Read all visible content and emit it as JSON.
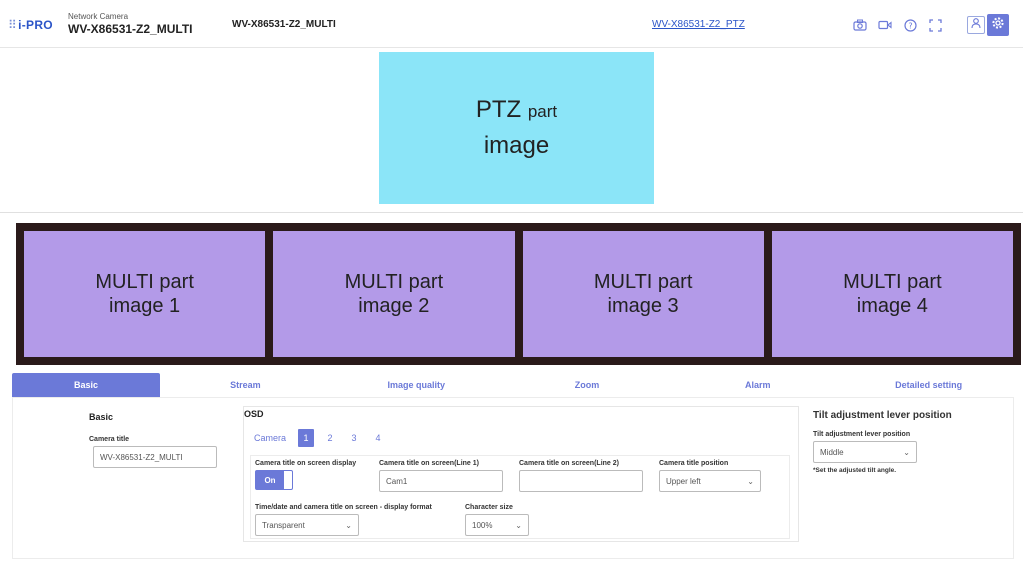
{
  "header": {
    "logo": "i-PRO",
    "logo_dots": "⠿",
    "model_sub": "Network Camera",
    "model_main": "WV-X86531-Z2_MULTI",
    "camera_name": "WV-X86531-Z2_MULTI",
    "ptz_link": "WV-X86531-Z2_PTZ"
  },
  "ptz_image": {
    "label_big": "PTZ",
    "label_small": "part",
    "label_line2": "image"
  },
  "multi_images": [
    {
      "line1": "MULTI part",
      "line2": "image 1"
    },
    {
      "line1": "MULTI part",
      "line2": "image 2"
    },
    {
      "line1": "MULTI part",
      "line2": "image 3"
    },
    {
      "line1": "MULTI part",
      "line2": "image 4"
    }
  ],
  "tabs": [
    "Basic",
    "Stream",
    "Image quality",
    "Zoom",
    "Alarm",
    "Detailed setting"
  ],
  "basic": {
    "title": "Basic",
    "camera_title_label": "Camera title",
    "camera_title_value": "WV-X86531-Z2_MULTI"
  },
  "osd": {
    "title": "OSD",
    "camera_tabs": [
      "Camera",
      "1",
      "2",
      "3",
      "4"
    ],
    "title_display_label": "Camera title on screen display",
    "toggle_value": "On",
    "line1_label": "Camera title on screen(Line 1)",
    "line1_value": "Cam1",
    "line2_label": "Camera title on screen(Line 2)",
    "line2_value": "",
    "position_label": "Camera title position",
    "position_value": "Upper left",
    "timedate_label": "Time/date and camera title on screen - display format",
    "timedate_value": "Transparent",
    "char_size_label": "Character size",
    "char_size_value": "100%"
  },
  "tilt": {
    "title": "Tilt adjustment lever position",
    "label": "Tilt adjustment lever position",
    "value": "Middle",
    "note": "*Set the adjusted tilt angle."
  },
  "colors": {
    "accent": "#6b79d8",
    "ptz_bg": "#8be5f8",
    "multi_bg": "#b39ae8",
    "multi_frame": "#2a1a1a"
  },
  "icons": [
    "camera-icon",
    "video-icon",
    "help-icon",
    "fullscreen-icon",
    "user-icon",
    "gear-icon"
  ]
}
